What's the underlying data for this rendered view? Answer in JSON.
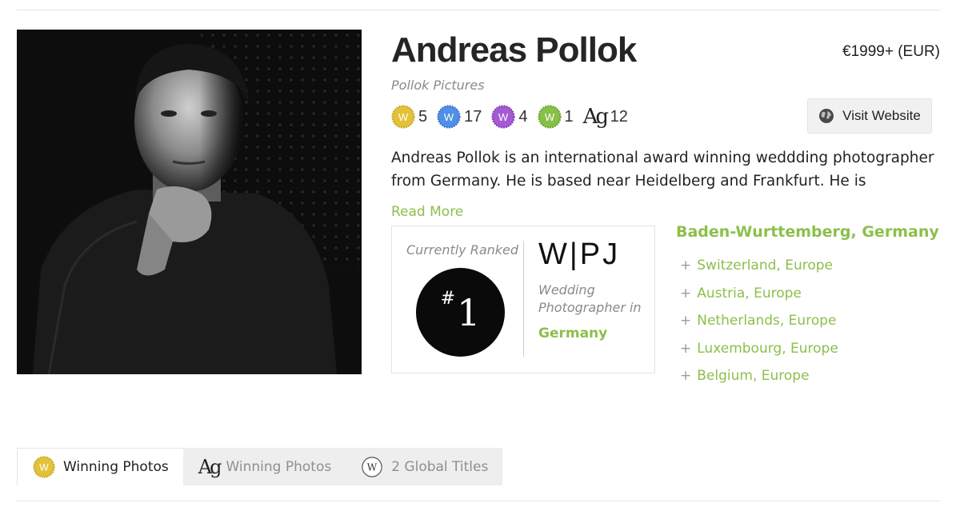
{
  "profile": {
    "name": "Andreas Pollok",
    "company": "Pollok Pictures",
    "price": "€1999+ (EUR)",
    "photo_alt": "Andreas Pollok portrait"
  },
  "badges": [
    {
      "icon": "gold-w-badge-icon",
      "color": "#e3c23a",
      "letter": "W",
      "count": "5"
    },
    {
      "icon": "blue-w-badge-icon",
      "color": "#4f8fe6",
      "letter": "W",
      "count": "17"
    },
    {
      "icon": "purple-w-badge-icon",
      "color": "#a35ad3",
      "letter": "W",
      "count": "4"
    },
    {
      "icon": "green-w-badge-icon",
      "color": "#86c047",
      "letter": "W",
      "count": "1"
    },
    {
      "icon": "ag-icon",
      "letter": "Ag",
      "count": "12"
    }
  ],
  "actions": {
    "visit_website": "Visit Website",
    "read_more": "Read More"
  },
  "bio": "Andreas Pollok is an international award winning weddding photographer from Germany. He is based near Heidelberg and Frankfurt. He is",
  "ranking": {
    "label": "Currently Ranked",
    "hash": "#",
    "rank": "1",
    "logo": "W|PJ",
    "desc_line1": "Wedding",
    "desc_line2": "Photographer in",
    "country": "Germany"
  },
  "locations": {
    "main": "Baden-Wurttemberg, Germany",
    "others": [
      "Switzerland, Europe",
      "Austria, Europe",
      "Netherlands, Europe",
      "Luxembourg, Europe",
      "Belgium, Europe"
    ]
  },
  "tabs": [
    {
      "label": "Winning Photos",
      "icon": "gold-w-badge-icon",
      "active": true
    },
    {
      "label": "Winning Photos",
      "icon": "ag-icon",
      "active": false
    },
    {
      "label": "2 Global Titles",
      "icon": "w-outline-icon",
      "active": false
    }
  ],
  "colors": {
    "accent_green": "#8cbf4b",
    "text_dark": "#222222",
    "muted": "#8a8a8a"
  }
}
